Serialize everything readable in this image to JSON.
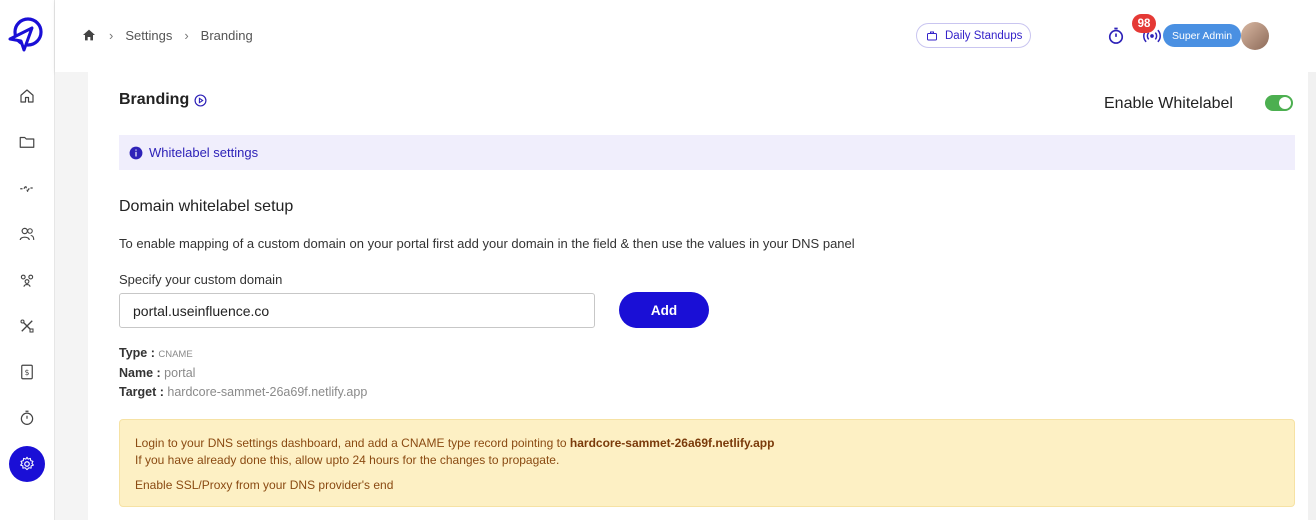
{
  "header": {
    "breadcrumbs": [
      "Settings",
      "Branding"
    ],
    "standup_label": "Daily Standups",
    "notification_count": "98",
    "role_label": "Super Admin"
  },
  "sidebar": {
    "items": [
      {
        "icon": "home-icon"
      },
      {
        "icon": "folder-icon"
      },
      {
        "icon": "activity-icon"
      },
      {
        "icon": "users-icon"
      },
      {
        "icon": "team-icon"
      },
      {
        "icon": "tools-icon"
      },
      {
        "icon": "billing-icon"
      },
      {
        "icon": "timer-icon"
      },
      {
        "icon": "settings-icon",
        "active": true
      }
    ]
  },
  "page": {
    "title": "Branding",
    "whitelabel_toggle_label": "Enable Whitelabel",
    "whitelabel_enabled": true,
    "info_text": "Whitelabel settings",
    "section_title": "Domain whitelabel setup",
    "description": "To enable mapping of a custom domain on your portal first add your domain in the field & then use the values in your DNS panel",
    "field_label": "Specify your custom domain",
    "domain_value": "portal.useinfluence.co",
    "add_button": "Add"
  },
  "dns_record": {
    "type_label": "Type :",
    "type_value": "CNAME",
    "name_label": "Name :",
    "name_value": "portal",
    "target_label": "Target :",
    "target_value": "hardcore-sammet-26a69f.netlify.app"
  },
  "note": {
    "line1_prefix": "Login to your DNS settings dashboard, and add a  CNAME type record pointing to ",
    "line1_target": "hardcore-sammet-26a69f.netlify.app",
    "line2": "If you have already done this, allow upto 24 hours for the changes to propagate.",
    "line3": "Enable SSL/Proxy from your DNS provider's end"
  },
  "colors": {
    "accent": "#1a0fd6",
    "toggle_on": "#4caf50",
    "badge": "#e53935",
    "role": "#4a90e2",
    "note_bg": "#fdf0c4"
  }
}
